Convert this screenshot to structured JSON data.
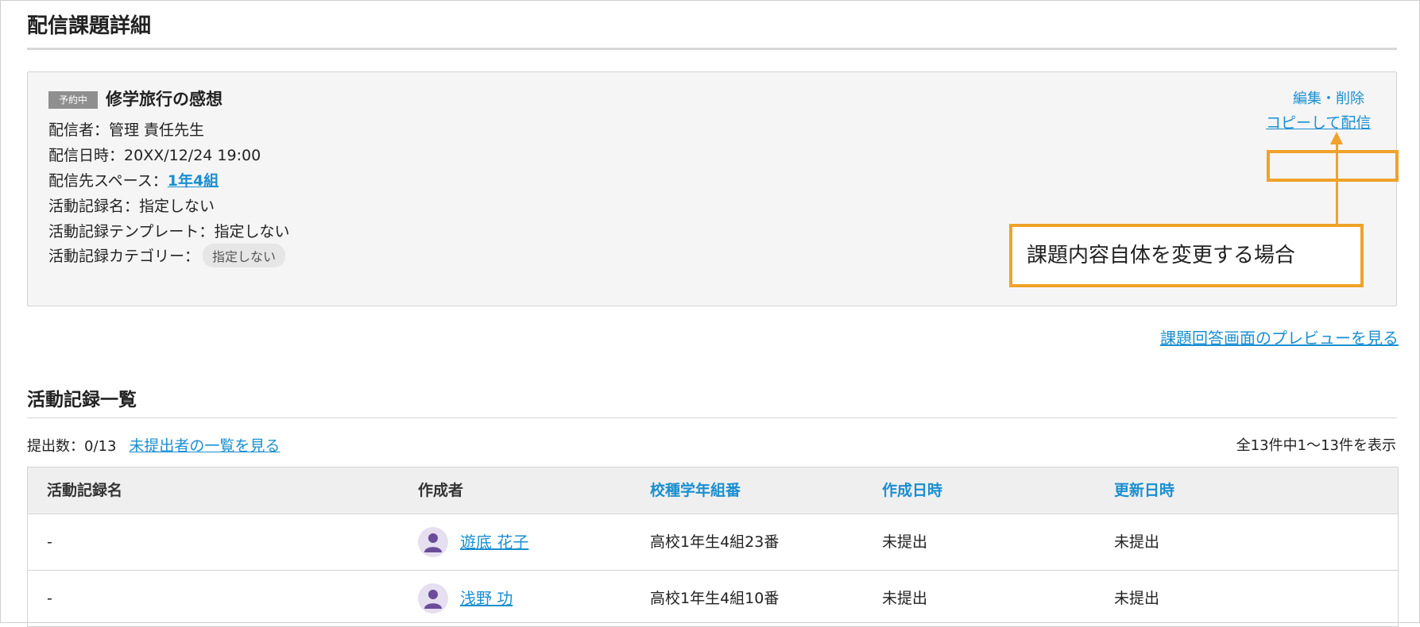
{
  "page": {
    "title": "配信課題詳細"
  },
  "assignment": {
    "status_badge": "予約中",
    "title": "修学旅行の感想",
    "sender_label": "配信者：",
    "sender_value": "管理 責任先生",
    "datetime_label": "配信日時：",
    "datetime_value": "20XX/12/24 19:00",
    "space_label": "配信先スペース：",
    "space_value": "1年4組",
    "record_name_label": "活動記録名：",
    "record_name_value": "指定しない",
    "template_label": "活動記録テンプレート：",
    "template_value": "指定しない",
    "category_label": "活動記録カテゴリー：",
    "category_value": "指定しない",
    "edit_delete": "編集・削除",
    "copy_distribute": "コピーして配信"
  },
  "callout": {
    "text": "課題内容自体を変更する場合",
    "color": "#f0a22a"
  },
  "preview_link": "課題回答画面のプレビューを見る",
  "records": {
    "section_title": "活動記録一覧",
    "submitted_label": "提出数：0/13",
    "unsubmitted_link": "未提出者の一覧を見る",
    "count_text": "全13件中1〜13件を表示",
    "columns": [
      "活動記録名",
      "作成者",
      "校種学年組番",
      "作成日時",
      "更新日時"
    ],
    "rows": [
      {
        "record_name": "-",
        "author": "遊底 花子",
        "class_no": "高校1年生4組23番",
        "created": "未提出",
        "updated": "未提出"
      },
      {
        "record_name": "-",
        "author": "浅野 功",
        "class_no": "高校1年生4組10番",
        "created": "未提出",
        "updated": "未提出"
      }
    ]
  },
  "colors": {
    "link": "#1a8fd0",
    "accent": "#f0a22a",
    "avatar": "#6b4c9a"
  }
}
